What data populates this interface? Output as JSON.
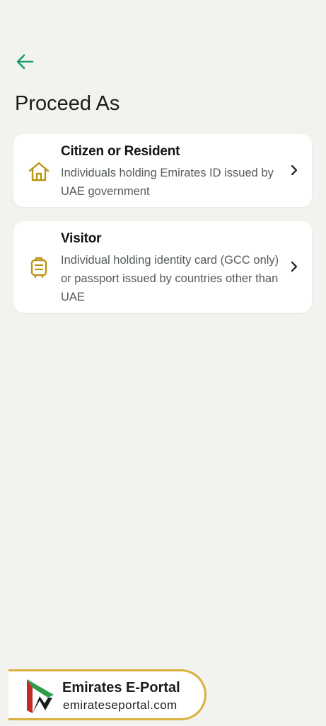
{
  "header": {
    "back_icon": "arrow-left-icon",
    "title": "Proceed As"
  },
  "options": [
    {
      "title": "Citizen or Resident",
      "description": "Individuals holding Emirates ID issued by UAE government",
      "icon": "home-icon"
    },
    {
      "title": "Visitor",
      "description": "Individual holding identity card (GCC only) or passport issued by countries other than UAE",
      "icon": "luggage-icon"
    }
  ],
  "watermark": {
    "name": "Emirates E-Portal",
    "url": "emirateseportal.com"
  },
  "colors": {
    "accent_green": "#1a9a6c",
    "icon_gold": "#b89514",
    "background": "#f2f3ef",
    "card": "#ffffff",
    "banner_border": "#d9b03c"
  }
}
